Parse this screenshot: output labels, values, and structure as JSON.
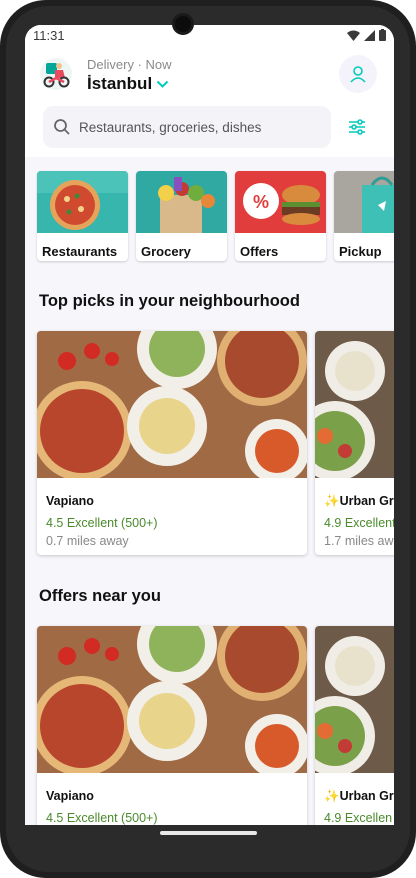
{
  "status_bar": {
    "time": "11:31"
  },
  "header": {
    "delivery_label": "Delivery · Now",
    "city": "İstanbul"
  },
  "search": {
    "placeholder": "Restaurants, groceries, dishes"
  },
  "categories": [
    {
      "label": "Restaurants"
    },
    {
      "label": "Grocery"
    },
    {
      "label": "Offers"
    },
    {
      "label": "Pickup"
    }
  ],
  "sections": [
    {
      "title": "Top picks in your neighbourhood",
      "cards": [
        {
          "name": "Vapiano",
          "rating": "4.5 Excellent (500+)",
          "distance": "0.7 miles away"
        },
        {
          "name": "✨Urban Gre",
          "rating": "4.9 Excellent",
          "distance": "1.7 miles aw"
        }
      ]
    },
    {
      "title": "Offers near you",
      "cards": [
        {
          "name": "Vapiano",
          "rating": "4.5 Excellent (500+)"
        },
        {
          "name": "✨Urban Gre",
          "rating": "4.9 Excellen"
        }
      ]
    }
  ],
  "colors": {
    "accent": "#00ccbc",
    "rating_green": "#4a8a2c",
    "background": "#f7f6fb"
  }
}
